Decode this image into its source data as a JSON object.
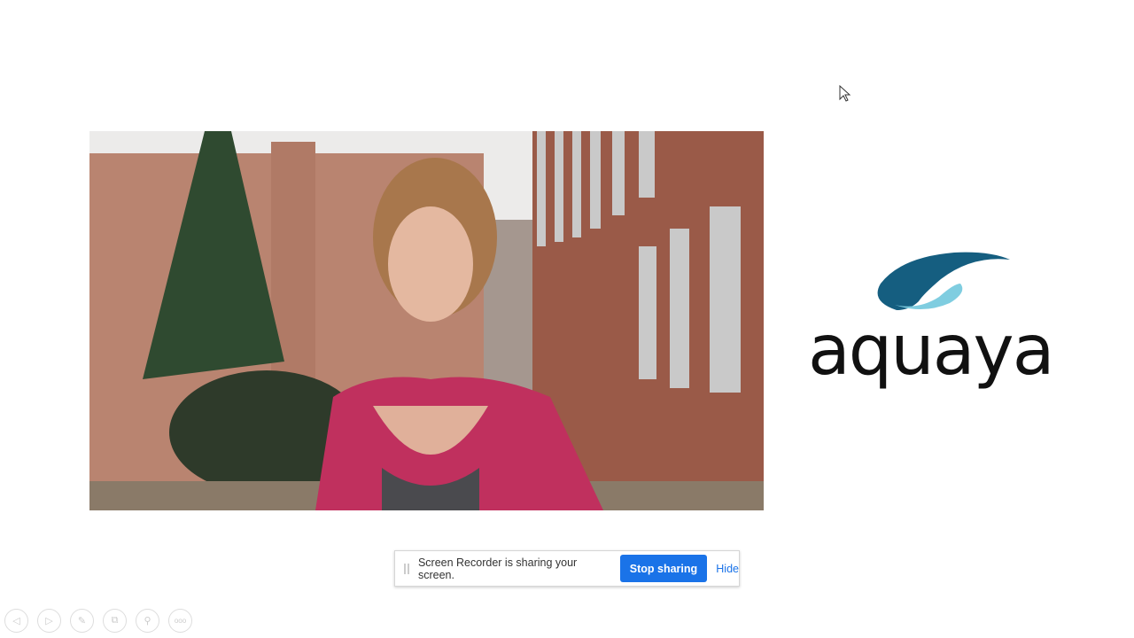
{
  "slide": {
    "photo_alt": "Portrait of a woman in a pink cardigan in front of brick buildings",
    "logo": {
      "wordmark": "aquaya",
      "colors": {
        "dark": "#155e80",
        "light": "#7fcde0"
      }
    }
  },
  "share_bar": {
    "message": "Screen Recorder is sharing your screen.",
    "stop_label": "Stop sharing",
    "hide_label": "Hide",
    "accent": "#1a73e8"
  },
  "controls": [
    {
      "icon": "previous-icon",
      "glyph": "◁"
    },
    {
      "icon": "next-icon",
      "glyph": "▷"
    },
    {
      "icon": "pen-icon",
      "glyph": "✎"
    },
    {
      "icon": "slides-icon",
      "glyph": "⧉"
    },
    {
      "icon": "zoom-icon",
      "glyph": "⚲"
    },
    {
      "icon": "more-icon",
      "glyph": "ooo"
    }
  ]
}
